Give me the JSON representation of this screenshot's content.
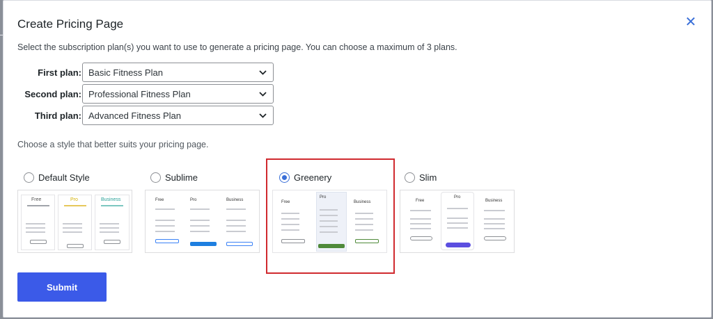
{
  "dialog": {
    "title": "Create Pricing Page",
    "description": "Select the subscription plan(s) you want to use to generate a pricing page. You can choose a maximum of 3 plans.",
    "plans": [
      {
        "label": "First plan:",
        "value": "Basic Fitness Plan"
      },
      {
        "label": "Second plan:",
        "value": "Professional Fitness Plan"
      },
      {
        "label": "Third plan:",
        "value": "Advanced Fitness Plan"
      }
    ],
    "style_description": "Choose a style that better suits your pricing page.",
    "styles": [
      {
        "label": "Default Style",
        "selected": false
      },
      {
        "label": "Sublime",
        "selected": false
      },
      {
        "label": "Greenery",
        "selected": true
      },
      {
        "label": "Slim",
        "selected": false
      }
    ],
    "thumb_text": {
      "default": [
        "Free",
        "Pro",
        "Business"
      ],
      "sublime": [
        "Free",
        "Pro",
        "Business"
      ],
      "greenery": [
        "Free",
        "Pro",
        "Business"
      ],
      "slim": [
        "Free",
        "Pro",
        "Business"
      ]
    },
    "submit_label": "Submit"
  },
  "colors": {
    "accent": "#3b5ae8",
    "radio": "#3a6fd8",
    "highlight": "#d0292e",
    "green": "#4f8a3a"
  },
  "icons": {
    "close": "close-icon",
    "dropdown": "chevron-down-icon"
  }
}
